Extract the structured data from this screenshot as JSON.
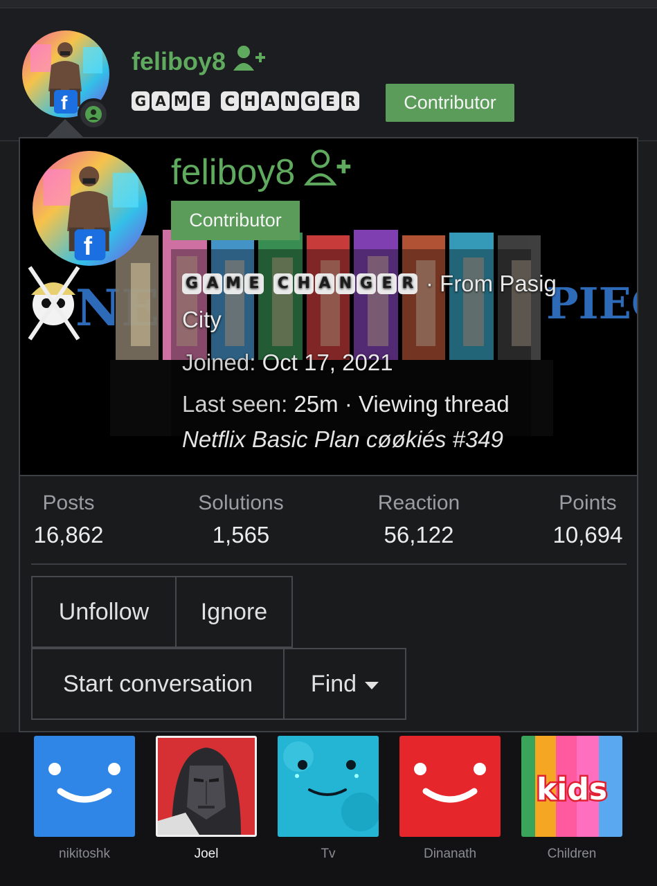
{
  "header": {
    "username": "feliboy8",
    "title_letters": [
      "G",
      "A",
      "M",
      "E",
      " ",
      "C",
      "H",
      "A",
      "N",
      "G",
      "E",
      "R"
    ],
    "badge": "Contributor"
  },
  "card": {
    "username": "feliboy8",
    "badge": "Contributor",
    "title_letters": [
      "G",
      "A",
      "M",
      "E",
      " ",
      "C",
      "H",
      "A",
      "N",
      "G",
      "E",
      "R"
    ],
    "location_prefix": "· From Pasig",
    "location_suffix": "City",
    "joined_label": "Joined:",
    "joined_value": "Oct 17, 2021",
    "last_seen_label": "Last seen:",
    "last_seen_value": "25m · Viewing thread",
    "thread_title": "Netflix Basic Plan cøøkiés #349",
    "stats": [
      {
        "label": "Posts",
        "value": "16,862"
      },
      {
        "label": "Solutions",
        "value": "1,565"
      },
      {
        "label": "Reaction",
        "value": "56,122"
      },
      {
        "label": "Points",
        "value": "10,694"
      }
    ],
    "buttons": {
      "unfollow": "Unfollow",
      "ignore": "Ignore",
      "start_conversation": "Start conversation",
      "find": "Find"
    }
  },
  "profiles": [
    {
      "name": "nikitoshk",
      "icon": "smile-icon",
      "color": "#2f86e6"
    },
    {
      "name": "Joel",
      "icon": "masked-figure-avatar",
      "color": "#e0383c"
    },
    {
      "name": "Tv",
      "icon": "blue-furry-monster-avatar",
      "color": "#1fb6d6"
    },
    {
      "name": "Dinanath",
      "icon": "smile-icon",
      "color": "#e5262b"
    },
    {
      "name": "Children",
      "icon": "kids-logo",
      "logo_text": "kids",
      "color": "#ff4f8f"
    }
  ],
  "colors": {
    "accent_green": "#5faa5e",
    "badge_green": "#5b9c5a",
    "background": "#1b1c1e"
  }
}
